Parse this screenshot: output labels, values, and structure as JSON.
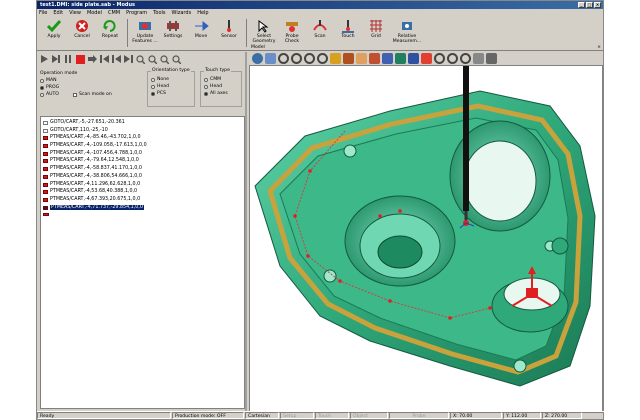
{
  "window": {
    "title": "test1.DMI: side plate.sab - Modus"
  },
  "menu": [
    "File",
    "Edit",
    "View",
    "Model",
    "CMM",
    "Program",
    "Tools",
    "Wizards",
    "Help"
  ],
  "toolbar": [
    {
      "label": "Apply",
      "icon": "check-icon"
    },
    {
      "label": "Cancel",
      "icon": "x-icon"
    },
    {
      "label": "Repeat",
      "icon": "repeat-icon"
    },
    {
      "label": "Update Features ...",
      "icon": "update-features-icon"
    },
    {
      "label": "Settings",
      "icon": "settings-icon"
    },
    {
      "label": "Move",
      "icon": "move-icon"
    },
    {
      "label": "Sensor",
      "icon": "sensor-icon"
    },
    {
      "label": "Select Geometry",
      "icon": "select-geometry-icon"
    },
    {
      "label": "Probe Check",
      "icon": "probe-check-icon"
    },
    {
      "label": "Scan",
      "icon": "scan-icon"
    },
    {
      "label": "Touch",
      "icon": "touch-icon"
    },
    {
      "label": "Grid",
      "icon": "grid-icon"
    },
    {
      "label": "Relative Measurem...",
      "icon": "relative-measurement-icon"
    }
  ],
  "operation_mode": {
    "title": "Operation mode",
    "options": [
      "MAN",
      "PROG",
      "AUTO"
    ],
    "selected": "PROG",
    "scan_mode_label": "Scan mode on"
  },
  "orientation_type": {
    "title": "Orientation type",
    "options": [
      "None",
      "Head",
      "PCS"
    ],
    "selected": "PCS"
  },
  "touch_type": {
    "title": "Touch type",
    "options": [
      "CMM",
      "Head",
      "All axes"
    ],
    "selected": "All axes"
  },
  "program_lines": [
    "GOTO/CART,-5,-27.651,-20.361",
    "GOTO/CART,110,-25,-10",
    "PTMEAS/CART,-4,-85.46,-43.702,1,0,0",
    "PTMEAS/CART,-4,-109.058,-17.613,1,0,0",
    "PTMEAS/CART,-4,-107.456,4.788,1,0,0",
    "PTMEAS/CART,-4,-79.64,12.548,1,0,0",
    "PTMEAS/CART,-4,-58.837,41.170,1,0,0",
    "PTMEAS/CART,-4,-38.806,54.666,1,0,0",
    "PTMEAS/CART,-4,11.296,62.628,1,0,0",
    "PTMEAS/CART,-4,53.68,40.388,1,0,0",
    "PTMEAS/CART,-4,67.393,20.675,1,0,0",
    "PTMEAS/CART,-4,71.737,-29.854,1,0,0"
  ],
  "selected_line": 11,
  "model_panel": {
    "title": "Model"
  },
  "status": {
    "ready": "Ready",
    "production_mode": "Production mode: OFF",
    "coord_system": "Cartesian",
    "setup": "Setup",
    "touch": "Touch",
    "object": "Object",
    "probe": "Probe",
    "x": "X: 70.00",
    "y": "Y: 112.00",
    "z": "Z: 270.00"
  },
  "colors": {
    "part_green": "#2fa87a",
    "plate_rim": "#c8a23c",
    "probe": "#111111",
    "selection": "#0a246a"
  }
}
